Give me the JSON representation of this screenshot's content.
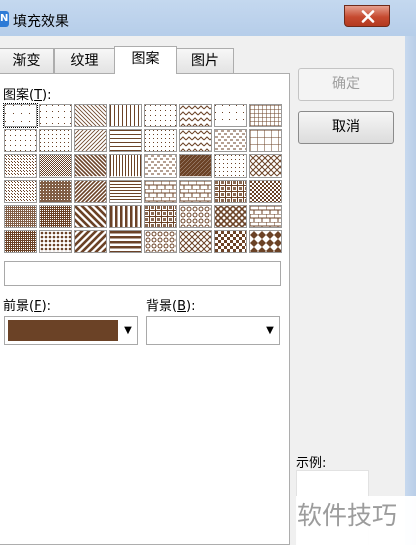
{
  "window": {
    "title": "填充效果",
    "app_icon_letter": "N"
  },
  "tabs": [
    {
      "label": "渐变",
      "active": false
    },
    {
      "label": "纹理",
      "active": false
    },
    {
      "label": "图案",
      "active": true
    },
    {
      "label": "图片",
      "active": false
    }
  ],
  "pattern_section": {
    "label": "图案(",
    "hotkey": "T",
    "label_end": "):",
    "selected_name": "",
    "pattern_color": "#6b4226",
    "patterns": [
      [
        "dots-5",
        "dots-10",
        "diag-light-down",
        "vert-light",
        "dots-60",
        "zigzag-light",
        "dots-sparse",
        "grid-small"
      ],
      [
        "dots-20",
        "dots-25",
        "diag-light-up",
        "horz-light",
        "dots-30",
        "zigzag",
        "confetti-small",
        "grid-large"
      ],
      [
        "dots-40",
        "dots-50",
        "diag-dark-down",
        "vert-narrow",
        "dash-horz",
        "diagonal-brick",
        "dots-random",
        "cross-diag"
      ],
      [
        "dots-70",
        "dots-75",
        "diag-dark-up",
        "horz-narrow",
        "brick-horz",
        "brick-diag",
        "weave",
        "checker-small"
      ],
      [
        "dots-80",
        "dots-90",
        "diag-wide-down",
        "vert-wide",
        "plaid",
        "sphere",
        "trellis",
        "shingle"
      ],
      [
        "dots-dense",
        "solid-dots",
        "diag-wide-up",
        "horz-wide",
        "divot",
        "diamond-outline",
        "checker-large",
        "diamond-solid"
      ]
    ]
  },
  "foreground": {
    "label": "前景(",
    "hotkey": "F",
    "label_end": "):",
    "color": "#6b4226"
  },
  "background": {
    "label": "背景(",
    "hotkey": "B",
    "label_end": "):",
    "color": "#ffffff"
  },
  "buttons": {
    "ok": "确定",
    "cancel": "取消"
  },
  "preview": {
    "label": "示例:"
  },
  "watermark": "软件技巧"
}
